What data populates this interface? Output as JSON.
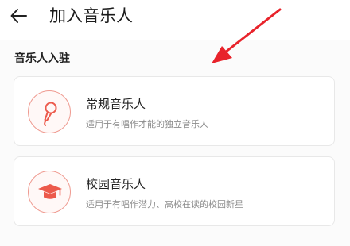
{
  "header": {
    "back_icon": "arrow-left-icon",
    "title": "加入音乐人"
  },
  "section": {
    "title": "音乐人入驻"
  },
  "options": [
    {
      "icon": "microphone-icon",
      "title": "常规音乐人",
      "description": "适用于有唱作才能的独立音乐人"
    },
    {
      "icon": "graduation-cap-icon",
      "title": "校园音乐人",
      "description": "适用于有唱作潜力、高校在读的校园新星"
    }
  ],
  "colors": {
    "accent": "#ec5a4c",
    "icon_ring": "#ef9a90",
    "annotation_arrow": "#e8232b",
    "card_border": "#e8e8e8",
    "page_background": "#fbfbfb"
  },
  "annotation": {
    "type": "arrow",
    "points_to": "section-header"
  }
}
